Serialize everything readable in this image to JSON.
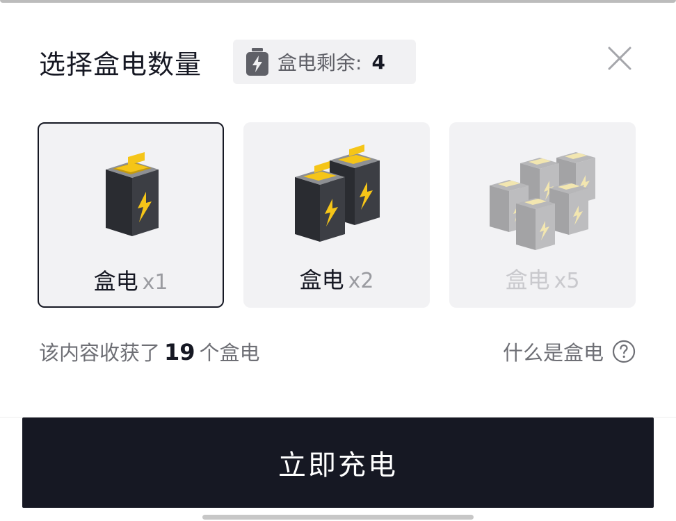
{
  "dialog": {
    "title": "选择盒电数量",
    "remain": {
      "label": "盒电剩余:",
      "count": "4",
      "icon": "battery-bolt-icon"
    },
    "close_icon": "close-icon"
  },
  "options": [
    {
      "name": "盒电",
      "mult": "x1",
      "selected": true,
      "disabled": false
    },
    {
      "name": "盒电",
      "mult": "x2",
      "selected": false,
      "disabled": false
    },
    {
      "name": "盒电",
      "mult": "x5",
      "selected": false,
      "disabled": true
    }
  ],
  "footer": {
    "note_prefix": "该内容收获了",
    "note_count": "19",
    "note_suffix": "个盒电",
    "help_label": "什么是盒电",
    "help_icon": "question-circle-icon"
  },
  "cta": {
    "label": "立即充电"
  },
  "colors": {
    "primary": "#161823",
    "card_bg": "#f2f2f4",
    "battery_top": "#f5c518",
    "disabled": "#c9c9cd"
  }
}
